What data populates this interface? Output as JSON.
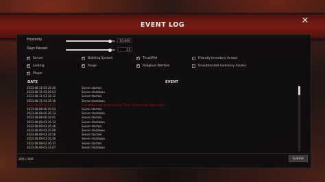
{
  "title": "EVENT LOG",
  "filters": {
    "proximity": {
      "label": "Proximity",
      "value": "10,000",
      "fraction": 0.89
    },
    "days_passed": {
      "label": "Days Passed",
      "value": "21",
      "fraction": 0.89
    }
  },
  "checkboxes": [
    {
      "label": "Server",
      "checked": true
    },
    {
      "label": "Building System",
      "checked": true
    },
    {
      "label": "Thrall/Pet",
      "checked": true
    },
    {
      "label": "Friendly Inventory Access",
      "checked": false
    },
    {
      "label": "Looting",
      "checked": true
    },
    {
      "label": "Purge",
      "checked": true
    },
    {
      "label": "Religious Warfare",
      "checked": true
    },
    {
      "label": "Unauthorized Inventory Access",
      "checked": false
    },
    {
      "label": "Player",
      "checked": true
    }
  ],
  "table": {
    "headers": {
      "date": "DATE",
      "event": "EVENT"
    },
    "rows": [
      {
        "date": "2023.08.11-03.29.36",
        "event": "Server started.",
        "red": false
      },
      {
        "date": "2023.08.11-03.26.03",
        "event": "Server shutdown.",
        "red": false
      },
      {
        "date": "2023.08.11-03.18.32",
        "event": "Server started.",
        "red": false
      },
      {
        "date": "2023.08.11-03.16.16",
        "event": "Server shutdown.",
        "red": false
      },
      {
        "date": "2023.08.09-01.07.33",
        "event": "Foundation was destroyed by Thrall (Grommash Hellscream)",
        "red": true
      },
      {
        "date": "2023.08.08-00.29.54",
        "event": "Server started.",
        "red": false
      },
      {
        "date": "2023.08.08-00.26.13",
        "event": "Server shutdown.",
        "red": false
      },
      {
        "date": "2023.08.08-00.18.01",
        "event": "Server started.",
        "red": false
      },
      {
        "date": "2023.08.08-03.16.33",
        "event": "Server shutdown.",
        "red": false
      },
      {
        "date": "2023.08.09-03.26.46",
        "event": "Server started.",
        "red": false
      },
      {
        "date": "2023.08.09-03.25.09",
        "event": "Server shutdown.",
        "red": false
      },
      {
        "date": "2023.08.09-03.18.56",
        "event": "Server started.",
        "red": false
      },
      {
        "date": "2023.08.09-03.16.40",
        "event": "Server shutdown.",
        "red": false
      },
      {
        "date": "2023.08.08-03.36.37",
        "event": "Server started.",
        "red": false
      },
      {
        "date": "2023.08.08-03.33.07",
        "event": "Server shutdown.",
        "red": false
      }
    ]
  },
  "footer": {
    "count": "200 / 200",
    "submit_label": "Submit"
  }
}
